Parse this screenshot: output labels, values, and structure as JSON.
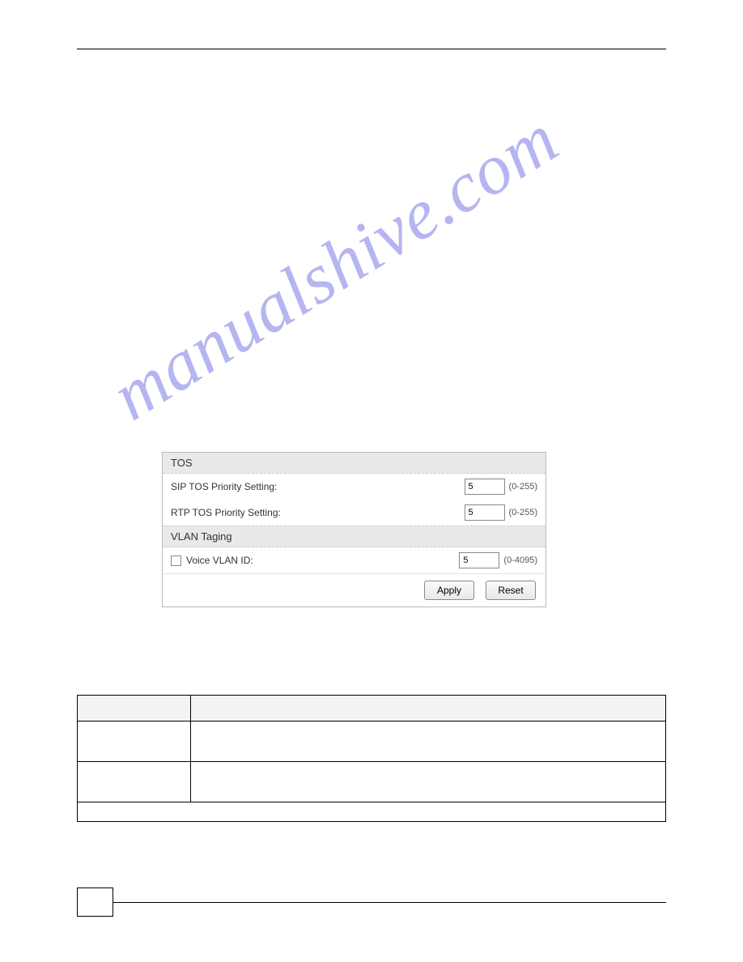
{
  "watermark": "manualshive.com",
  "panel": {
    "tos": {
      "header": "TOS",
      "sip_label": "SIP TOS Priority Setting:",
      "sip_value": "5",
      "sip_range": "(0-255)",
      "rtp_label": "RTP TOS Priority Setting:",
      "rtp_value": "5",
      "rtp_range": "(0-255)"
    },
    "vlan": {
      "header": "VLAN Taging",
      "voice_label": "Voice VLAN ID:",
      "voice_value": "5",
      "voice_range": "(0-4095)"
    },
    "buttons": {
      "apply": "Apply",
      "reset": "Reset"
    }
  }
}
